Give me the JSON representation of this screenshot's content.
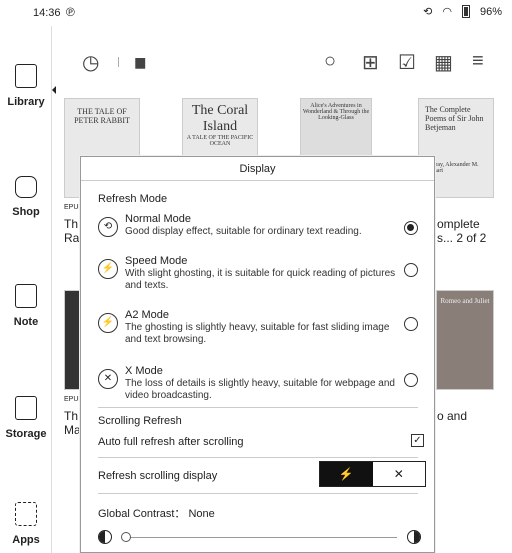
{
  "status": {
    "time": "14:36",
    "app_indicator": "℗",
    "sync": "⟲",
    "wifi": "◠",
    "battery": "96%"
  },
  "sidebar": {
    "items": [
      {
        "label": "Library",
        "icon": "library-icon"
      },
      {
        "label": "Shop",
        "icon": "shop-icon"
      },
      {
        "label": "Note",
        "icon": "note-icon"
      },
      {
        "label": "Storage",
        "icon": "storage-icon"
      },
      {
        "label": "Apps",
        "icon": "apps-icon"
      }
    ]
  },
  "toolbar": {
    "history": "◷",
    "stats": "▮▮",
    "search": "○",
    "add": "⊞",
    "select": "☑",
    "grid": "▦",
    "menu": "≡"
  },
  "books": [
    {
      "title": "THE TALE OF PETER RABBIT",
      "meta_line1": "Th",
      "meta_line2": "Ra",
      "badge": "EPUB"
    },
    {
      "title": "The Coral Island",
      "subtitle": "A TALE OF THE PACIFIC OCEAN"
    },
    {
      "title": "Alice's Adventures in Wonderland & Through the Looking-Glass"
    },
    {
      "title": "The Complete Poems of Sir John Betjeman",
      "meta_line1": "omplete",
      "meta_line2": "s... 2 of 2",
      "author": "Murray, Alexander M. Grosart"
    },
    {
      "meta_line1": "Th",
      "meta_line2": "Ma",
      "badge": "EPUB"
    },
    {
      "title": "Romeo and Juliet",
      "meta_line1": "o and"
    }
  ],
  "dialog": {
    "title": "Display",
    "refresh_mode_label": "Refresh Mode",
    "modes": [
      {
        "name": "Normal Mode",
        "desc": "Good display effect, suitable for ordinary text reading.",
        "checked": true
      },
      {
        "name": "Speed Mode",
        "desc": "With slight ghosting, it is suitable for quick reading of pictures and texts.",
        "checked": false
      },
      {
        "name": "A2 Mode",
        "desc": "The ghosting is slightly heavy, suitable for fast sliding image and text browsing.",
        "checked": false
      },
      {
        "name": "X Mode",
        "desc": "The loss of details is slightly heavy, suitable for webpage and video broadcasting.",
        "checked": false
      }
    ],
    "scrolling_refresh_label": "Scrolling Refresh",
    "auto_refresh_label": "Auto full refresh after scrolling",
    "auto_refresh_checked": true,
    "refresh_scrolling_display_label": "Refresh scrolling display",
    "global_contrast_label": "Global Contrast： None",
    "contrast_value": 0
  }
}
